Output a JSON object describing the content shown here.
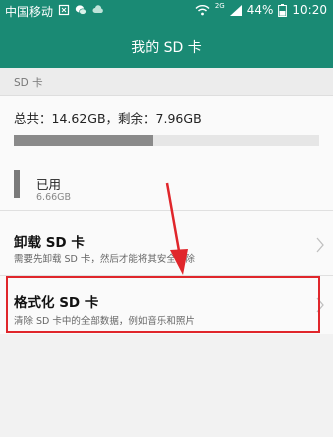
{
  "status_bar": {
    "carrier": "中国移动",
    "signal_label": "2G",
    "battery": "44%",
    "time": "10:20"
  },
  "header": {
    "title": "我的 SD 卡"
  },
  "section": {
    "label": "SD 卡"
  },
  "storage": {
    "summary": "总共：14.62GB，剩余：7.96GB",
    "used_fraction": 0.455,
    "used_label": "已用",
    "used_size": "6.66GB"
  },
  "items": [
    {
      "title": "卸载 SD 卡",
      "desc": "需要先卸载 SD 卡，然后才能将其安全移除"
    },
    {
      "title": "格式化 SD 卡",
      "desc": "清除 SD 卡中的全部数据，例如音乐和照片"
    }
  ],
  "colors": {
    "header_bg": "#1a8a74",
    "highlight": "#e0262b",
    "usage_fill": "#8a8a8a"
  },
  "icons": {
    "sim": "sim-card-icon",
    "wechat": "wechat-icon",
    "cloud": "cloud-icon",
    "wifi": "wifi-icon",
    "signal": "signal-icon",
    "battery": "battery-icon",
    "chevron": "chevron-right-icon"
  }
}
